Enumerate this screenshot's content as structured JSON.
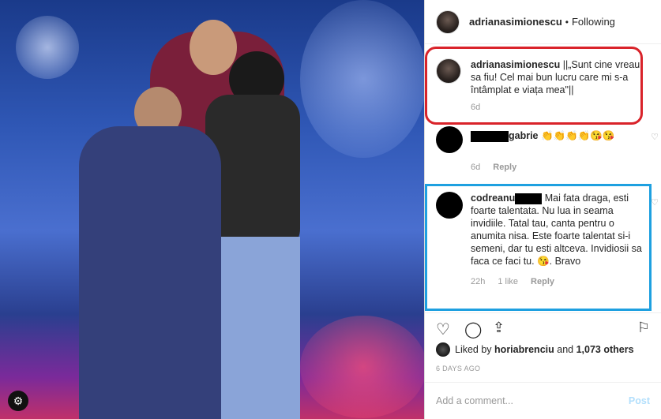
{
  "post": {
    "username": "adrianasimionescu",
    "separator": "•",
    "follow_status": "Following"
  },
  "caption": {
    "username": "adrianasimionescu",
    "text": "||„Sunt cine vreau sa fiu! Cel mai bun lucru care mi s-a întâmplat e viața mea\"||",
    "time": "6d"
  },
  "comments": [
    {
      "username_suffix": "gabrie",
      "text": "👏👏👏👏😘😘",
      "time": "6d",
      "reply": "Reply"
    },
    {
      "username_prefix": "codreanu",
      "text": "Mai fata draga, esti foarte talentata. Nu lua in seama invidiile. Tatal tau, canta pentru o anumita nisa. Este foarte talentat si-i semeni, dar tu esti altceva. Invidiosii sa faca ce faci tu. 😘. Bravo",
      "time": "22h",
      "likes": "1 like",
      "reply": "Reply"
    }
  ],
  "likes_line": {
    "prefix": "Liked by",
    "user": "horiabrenciu",
    "middle": "and",
    "count": "1,073 others"
  },
  "date": "6 DAYS AGO",
  "add_comment": {
    "placeholder": "Add a comment...",
    "post_label": "Post"
  },
  "icons": {
    "like": "heart-icon",
    "comment": "comment-icon",
    "share": "share-icon",
    "save": "bookmark-icon",
    "settings": "gear-icon"
  },
  "colors": {
    "highlight_red": "#d9232a",
    "highlight_blue": "#1ea0e0",
    "post_button": "#b2dffc"
  }
}
